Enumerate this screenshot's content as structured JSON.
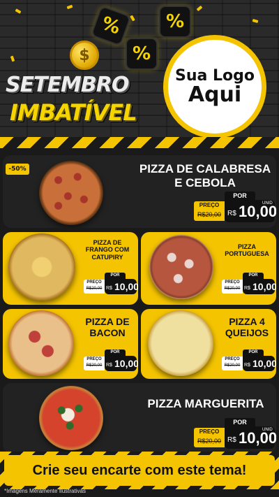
{
  "header": {
    "title_line1": "SETEMBRO",
    "title_line2": "IMBATÍVEL",
    "coin_symbol": "$",
    "percent_symbol": "%",
    "logo_line1": "Sua Logo",
    "logo_line2": "Aqui"
  },
  "discount_badge": "-50%",
  "price_labels": {
    "por": "POR",
    "preco": "PREÇO",
    "old_price": "R$20,00",
    "currency": "R$",
    "new_price": "10,00",
    "unit": "UNID"
  },
  "products": [
    {
      "name_line1": "PIZZA DE CALABRESA",
      "name_line2": "E CEBOLA"
    },
    {
      "name_line1": "PIZZA DE",
      "name_line2": "FRANGO COM",
      "name_line3": "CATUPIRY"
    },
    {
      "name_line1": "PIZZA",
      "name_line2": "PORTUGUESA"
    },
    {
      "name_line1": "PIZZA DE",
      "name_line2": "BACON"
    },
    {
      "name_line1": "PIZZA 4",
      "name_line2": "QUEIJOS"
    },
    {
      "name_line1": "PIZZA MARGUERITA"
    }
  ],
  "cta": "Crie seu encarte com este tema!",
  "disclaimer": "*Imagens Meramente Ilustrativas",
  "colors": {
    "accent": "#f5c400",
    "dark": "#1a1a1a",
    "card_dark": "#222222"
  }
}
